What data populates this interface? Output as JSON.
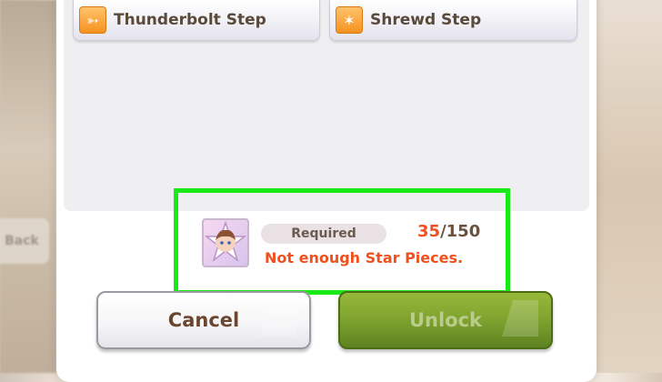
{
  "skills": [
    {
      "label": "Thunderbolt Step",
      "icon": "speed-arrow-icon"
    },
    {
      "label": "Shrewd Step",
      "icon": "sparkle-star-icon"
    }
  ],
  "requirement": {
    "pill_label": "Required",
    "have": "35",
    "separator": "/",
    "need": "150",
    "error": "Not enough Star Pieces."
  },
  "buttons": {
    "cancel": "Cancel",
    "unlock": "Unlock"
  },
  "background": {
    "back_label": "Back"
  },
  "colors": {
    "highlight": "#18ea18",
    "error": "#f0501e",
    "unlock_bg": "#7ea22e",
    "skill_icon": "#f5921f"
  }
}
